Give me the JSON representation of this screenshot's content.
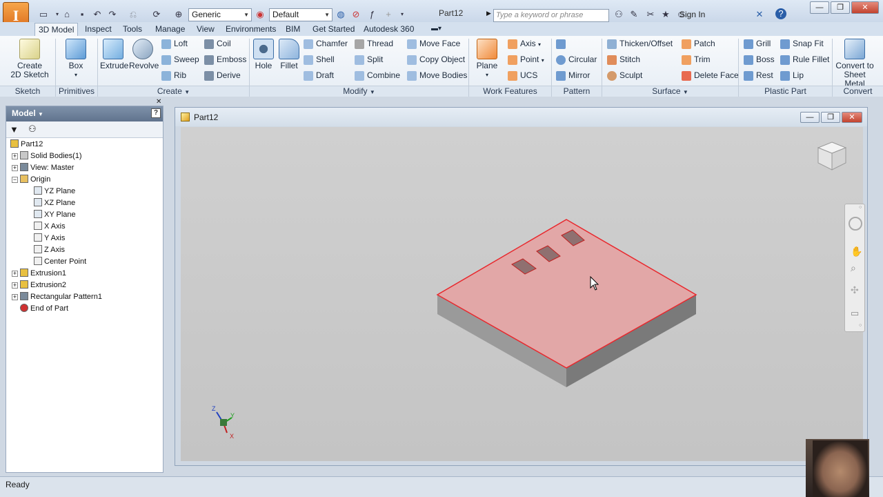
{
  "app": {
    "logo_letter": "I"
  },
  "quick_access": {
    "appearance_value": "Generic",
    "material_value": "Default",
    "document_title": "Part12",
    "search_placeholder": "Type a keyword or phrase",
    "sign_in": "Sign In"
  },
  "tabs": [
    "3D Model",
    "Inspect",
    "Tools",
    "Manage",
    "View",
    "Environments",
    "BIM",
    "Get Started",
    "Autodesk 360"
  ],
  "ribbon": {
    "groups": [
      "Sketch",
      "Primitives",
      "Create",
      "Modify",
      "Work Features",
      "Pattern",
      "Surface",
      "Plastic Part",
      "Convert"
    ],
    "create_sketch": "Create\n2D Sketch",
    "create_sketch_l1": "Create",
    "create_sketch_l2": "2D Sketch",
    "box": "Box",
    "extrude": "Extrude",
    "revolve": "Revolve",
    "loft": "Loft",
    "sweep": "Sweep",
    "rib": "Rib",
    "coil": "Coil",
    "emboss": "Emboss",
    "derive": "Derive",
    "hole": "Hole",
    "fillet": "Fillet",
    "chamfer": "Chamfer",
    "shell": "Shell",
    "draft": "Draft",
    "thread": "Thread",
    "split": "Split",
    "combine": "Combine",
    "move_face": "Move Face",
    "copy_object": "Copy Object",
    "move_bodies": "Move Bodies",
    "plane": "Plane",
    "axis": "Axis",
    "point": "Point",
    "ucs": "UCS",
    "circular": "Circular",
    "mirror": "Mirror",
    "thicken": "Thicken/Offset",
    "stitch": "Stitch",
    "sculpt": "Sculpt",
    "patch": "Patch",
    "trim": "Trim",
    "delete_face": "Delete Face",
    "grill": "Grill",
    "boss": "Boss",
    "rest": "Rest",
    "snap_fit": "Snap Fit",
    "rule_fillet": "Rule Fillet",
    "lip": "Lip",
    "convert_l1": "Convert to",
    "convert_l2": "Sheet Metal"
  },
  "browser": {
    "title": "Model",
    "tree": [
      {
        "label": "Part12",
        "level": 0,
        "expand": "",
        "icon": "part-icon"
      },
      {
        "label": "Solid Bodies(1)",
        "level": 1,
        "expand": "+",
        "icon": "solid-bodies-icon"
      },
      {
        "label": "View: Master",
        "level": 1,
        "expand": "+",
        "icon": "view-icon"
      },
      {
        "label": "Origin",
        "level": 1,
        "expand": "-",
        "icon": "folder-icon"
      },
      {
        "label": "YZ Plane",
        "level": 2,
        "expand": "",
        "icon": "plane-icon"
      },
      {
        "label": "XZ Plane",
        "level": 2,
        "expand": "",
        "icon": "plane-icon"
      },
      {
        "label": "XY Plane",
        "level": 2,
        "expand": "",
        "icon": "plane-icon"
      },
      {
        "label": "X Axis",
        "level": 2,
        "expand": "",
        "icon": "axis-icon"
      },
      {
        "label": "Y Axis",
        "level": 2,
        "expand": "",
        "icon": "axis-icon"
      },
      {
        "label": "Z Axis",
        "level": 2,
        "expand": "",
        "icon": "axis-icon"
      },
      {
        "label": "Center Point",
        "level": 2,
        "expand": "",
        "icon": "point-icon"
      },
      {
        "label": "Extrusion1",
        "level": 1,
        "expand": "+",
        "icon": "extrusion-icon"
      },
      {
        "label": "Extrusion2",
        "level": 1,
        "expand": "+",
        "icon": "extrusion-icon"
      },
      {
        "label": "Rectangular Pattern1",
        "level": 1,
        "expand": "+",
        "icon": "pattern-icon"
      },
      {
        "label": "End of Part",
        "level": 1,
        "expand": "",
        "icon": "end-of-part-icon"
      }
    ]
  },
  "document": {
    "tab_title": "Part12"
  },
  "triad": {
    "x": "X",
    "y": "Y",
    "z": "Z"
  },
  "status": {
    "text": "Ready"
  },
  "colors": {
    "accent": "#e07a20",
    "selection": "#e8282d",
    "face_fill": "#e2a7a7"
  }
}
